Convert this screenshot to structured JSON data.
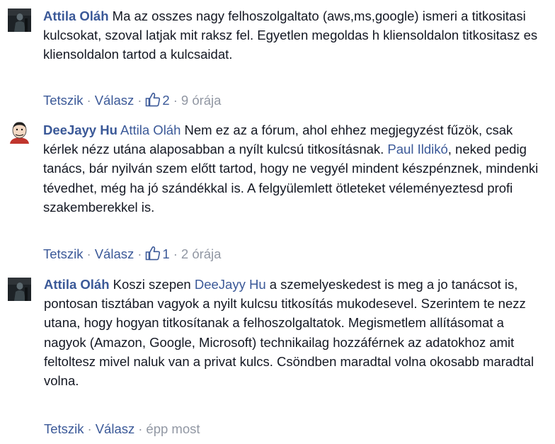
{
  "comments": [
    {
      "author": "Attila Oláh",
      "text_parts": [
        {
          "type": "text",
          "value": " Ma az osszes nagy felhoszolgaltato (aws,ms,google) ismeri a titkositasi kulcsokat, szoval latjak mit raksz fel. Egyetlen megoldas h kliensoldalon titkositasz es kliensoldalon tartod a kulcsaidat."
        }
      ],
      "actions": {
        "like_label": "Tetszik",
        "reply_label": "Válasz",
        "like_count": "2",
        "time": "9 órája"
      },
      "avatar": "user-photo-dark"
    },
    {
      "author": "DeeJayy Hu",
      "text_parts": [
        {
          "type": "text",
          "value": " "
        },
        {
          "type": "mention",
          "value": "Attila Oláh"
        },
        {
          "type": "text",
          "value": " Nem ez az a fórum, ahol ehhez megjegyzést fűzök, csak kérlek nézz utána alaposabban a nyílt kulcsú titkosításnak. "
        },
        {
          "type": "mention",
          "value": "Paul Ildikó"
        },
        {
          "type": "text",
          "value": ", neked pedig tanács, bár nyilván szem előtt tartod, hogy ne vegyél mindent készpénznek, mindenki tévedhet, még ha jó szándékkal is. A felgyülemlett ötleteket véleményeztesd profi szakemberekkel is."
        }
      ],
      "actions": {
        "like_label": "Tetszik",
        "reply_label": "Válasz",
        "like_count": "1",
        "time": "2 órája"
      },
      "avatar": "user-photo-cartoon"
    },
    {
      "author": "Attila Oláh",
      "text_parts": [
        {
          "type": "text",
          "value": " Koszi szepen "
        },
        {
          "type": "mention",
          "value": "DeeJayy Hu"
        },
        {
          "type": "text",
          "value": " a szemelyeskedest is meg a jo tanácsot is, pontosan tisztában vagyok a nyilt kulcsu titkosítás mukodesevel. Szerintem te nezz utana, hogy hogyan titkosítanak a felhoszolgaltatok. Megismetlem allításomat a nagyok (Amazon, Google, Microsoft) technikailag hozzáférnek az adatokhoz amit feltoltesz mivel naluk van a privat kulcs. Csöndben maradtal volna okosabb maradtal volna."
        }
      ],
      "actions": {
        "like_label": "Tetszik",
        "reply_label": "Válasz",
        "like_count": "",
        "time": "épp most"
      },
      "avatar": "user-photo-dark"
    }
  ],
  "colors": {
    "link": "#3b5998",
    "text": "#141823",
    "meta": "#9197a3"
  },
  "icons": {
    "like": "thumbs-up-icon"
  }
}
